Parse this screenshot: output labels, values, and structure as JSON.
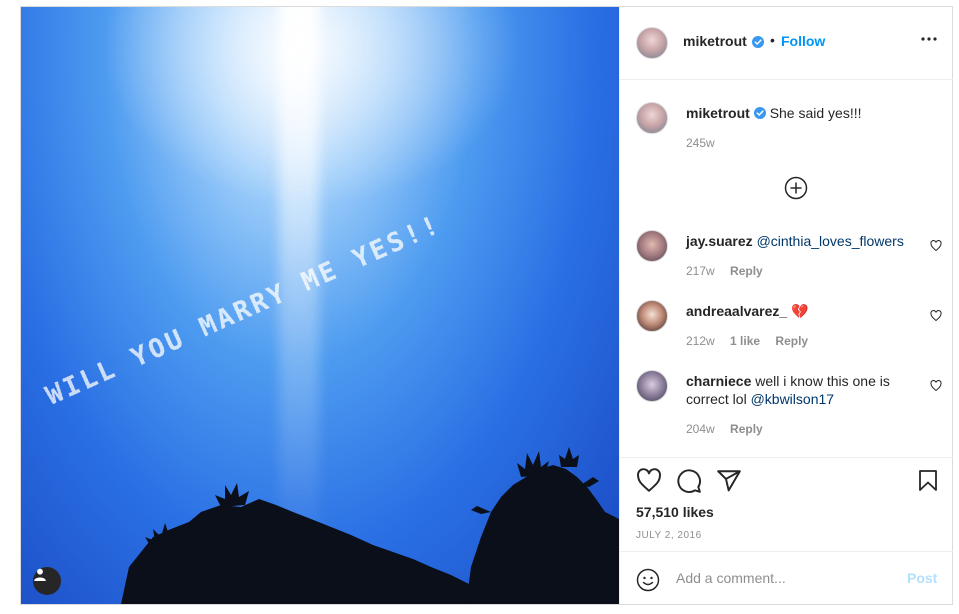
{
  "post": {
    "author": {
      "username": "miketrout",
      "verified": true,
      "follow_label": "Follow",
      "separator": "•"
    },
    "caption": {
      "username": "miketrout",
      "text": "She said yes!!!",
      "age": "245w"
    },
    "skywriting_text": "WILL YOU MARRY ME YES!!",
    "comments": [
      {
        "username": "jay.suarez",
        "text": "@cinthia_loves_flowers",
        "age": "217w",
        "likes": "",
        "reply_label": "Reply"
      },
      {
        "username": "andreaalvarez_",
        "text": "💔",
        "age": "212w",
        "likes": "1 like",
        "reply_label": "Reply"
      },
      {
        "username": "charniece",
        "text": "well i know this one is correct lol",
        "mention": "@kbwilson17",
        "age": "204w",
        "likes": "",
        "reply_label": "Reply"
      }
    ],
    "likes_text": "57,510 likes",
    "date": "JULY 2, 2016",
    "add_comment": {
      "placeholder": "Add a comment...",
      "post_label": "Post"
    }
  },
  "colors": {
    "link_blue": "#0095f6",
    "mention": "#00376b",
    "muted": "#8e8e8e",
    "post_disabled": "#b2dffc",
    "verified": "#3897f0"
  },
  "icons": [
    "verified-icon",
    "more-icon",
    "load-more-icon",
    "heart-icon",
    "comment-icon",
    "share-icon",
    "bookmark-icon",
    "emoji-icon",
    "user-tag-icon"
  ]
}
